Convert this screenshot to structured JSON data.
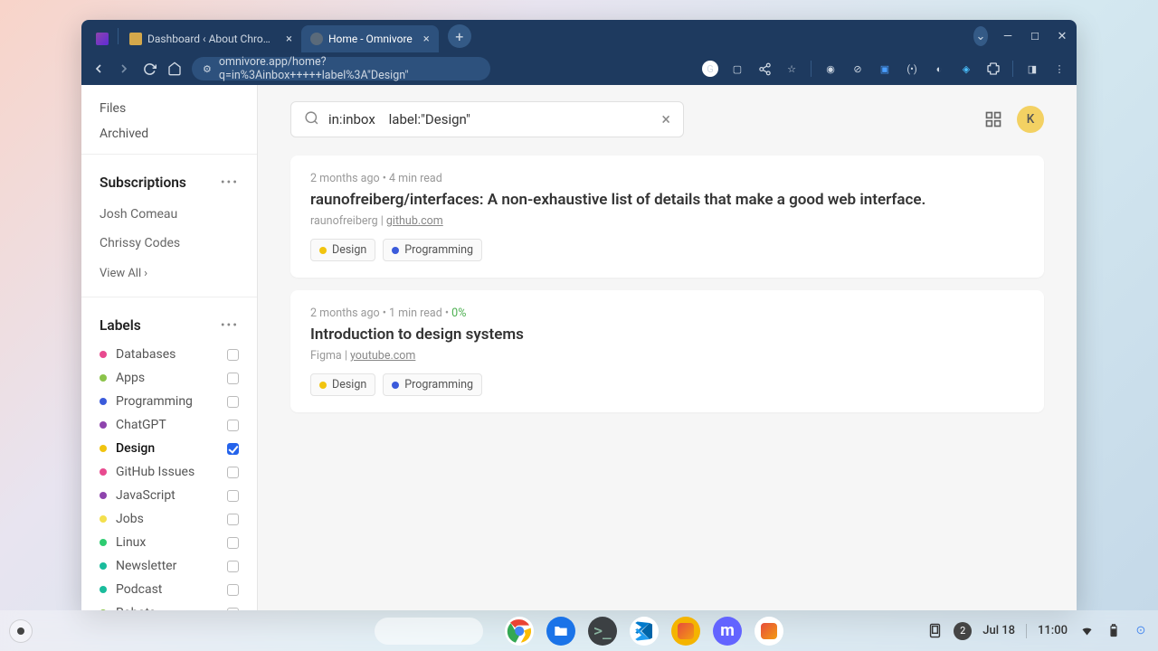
{
  "browser": {
    "tabs": [
      {
        "label": "Dashboard ‹ About Chromeboo",
        "active": false
      },
      {
        "label": "Home - Omnivore",
        "active": true
      }
    ],
    "url": "omnivore.app/home?q=in%3Ainbox+++++label%3A\"Design\"",
    "window_controls": {
      "dropdown": "⌄",
      "min": "—",
      "max": "▢",
      "close": "✕"
    }
  },
  "sidebar": {
    "quick": [
      "Files",
      "Archived"
    ],
    "subscriptions": {
      "heading": "Subscriptions",
      "items": [
        "Josh Comeau",
        "Chrissy Codes"
      ],
      "view_all": "View All"
    },
    "labels": {
      "heading": "Labels",
      "items": [
        {
          "name": "Databases",
          "color": "#e84a8f",
          "checked": false
        },
        {
          "name": "Apps",
          "color": "#8bc34a",
          "checked": false
        },
        {
          "name": "Programming",
          "color": "#3b5bdb",
          "checked": false
        },
        {
          "name": "ChatGPT",
          "color": "#8e44ad",
          "checked": false
        },
        {
          "name": "Design",
          "color": "#f1c40f",
          "checked": true
        },
        {
          "name": "GitHub Issues",
          "color": "#e84a8f",
          "checked": false
        },
        {
          "name": "JavaScript",
          "color": "#8e44ad",
          "checked": false
        },
        {
          "name": "Jobs",
          "color": "#f4e04d",
          "checked": false
        },
        {
          "name": "Linux",
          "color": "#2ecc71",
          "checked": false
        },
        {
          "name": "Newsletter",
          "color": "#1abc9c",
          "checked": false
        },
        {
          "name": "Podcast",
          "color": "#1abc9c",
          "checked": false
        },
        {
          "name": "Robots",
          "color": "#8bc34a",
          "checked": false
        }
      ]
    }
  },
  "search": {
    "value": "in:inbox    label:\"Design\""
  },
  "avatar": "K",
  "articles": [
    {
      "age": "2 months ago",
      "read_time": "4 min read",
      "progress": "",
      "title": "raunofreiberg/interfaces: A non-exhaustive list of details that make a good web interface.",
      "author": "raunofreiberg",
      "domain": "github.com",
      "tags": [
        {
          "name": "Design",
          "color": "#f1c40f"
        },
        {
          "name": "Programming",
          "color": "#3b5bdb"
        }
      ]
    },
    {
      "age": "2 months ago",
      "read_time": "1 min read",
      "progress": "0%",
      "title": "Introduction to design systems",
      "author": "Figma",
      "domain": "youtube.com",
      "tags": [
        {
          "name": "Design",
          "color": "#f1c40f"
        },
        {
          "name": "Programming",
          "color": "#3b5bdb"
        }
      ]
    }
  ],
  "shelf": {
    "apps": [
      {
        "name": "chrome",
        "bg": "#fff"
      },
      {
        "name": "files",
        "bg": "#1a73e8"
      },
      {
        "name": "terminal",
        "bg": "#3c4043"
      },
      {
        "name": "vscode",
        "bg": "#fff"
      },
      {
        "name": "app5",
        "bg": "#f4b400"
      },
      {
        "name": "mastodon",
        "bg": "#6364ff"
      },
      {
        "name": "app7",
        "bg": "#fff"
      }
    ],
    "notifications": "2",
    "date": "Jul 18",
    "time": "11:00"
  }
}
